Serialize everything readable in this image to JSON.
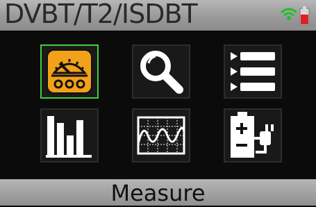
{
  "header": {
    "title": "DVBT/T2/ISDBT"
  },
  "status": {
    "signal_icon": "wifi-signal-icon",
    "battery_icon": "battery-low-icon",
    "signal_color": "#22c02a",
    "battery_color": "#e02020"
  },
  "menu": {
    "items": [
      {
        "name": "measure",
        "icon": "meter-icon",
        "selected": true
      },
      {
        "name": "search",
        "icon": "magnifier-icon",
        "selected": false
      },
      {
        "name": "list",
        "icon": "list-icon",
        "selected": false
      },
      {
        "name": "bar-graph",
        "icon": "bar-chart-icon",
        "selected": false
      },
      {
        "name": "spectrum",
        "icon": "waveform-icon",
        "selected": false
      },
      {
        "name": "power",
        "icon": "battery-charging-icon",
        "selected": false
      }
    ]
  },
  "footer": {
    "label": "Measure"
  },
  "colors": {
    "accent": "#f2a119",
    "selection": "#3fcf3f"
  }
}
